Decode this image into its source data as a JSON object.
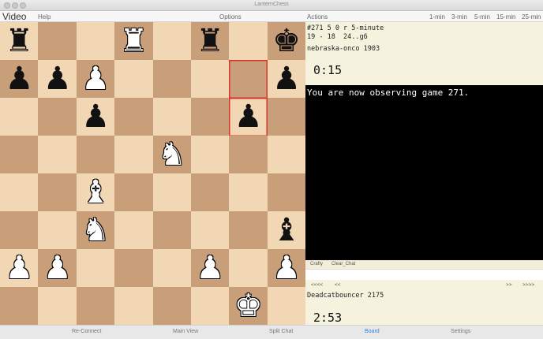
{
  "window": {
    "title": "LanternChess"
  },
  "menubar": {
    "video": "Video",
    "help": "Help",
    "options": "Options",
    "actions": "Actions",
    "time_buttons": [
      "1-min",
      "3-min",
      "5-min",
      "15-min",
      "25-min"
    ]
  },
  "board": {
    "squares": [
      [
        "bR",
        "",
        "",
        "wR",
        "",
        "bR",
        "",
        "bK"
      ],
      [
        "bP",
        "bP",
        "wP",
        "",
        "",
        "",
        "",
        "bP"
      ],
      [
        "",
        "",
        "bP",
        "",
        "",
        "",
        "bP",
        ""
      ],
      [
        "",
        "",
        "",
        "",
        "wN",
        "",
        "",
        ""
      ],
      [
        "",
        "",
        "wB",
        "",
        "",
        "",
        "",
        ""
      ],
      [
        "",
        "",
        "wN",
        "",
        "",
        "",
        "",
        "bB"
      ],
      [
        "wP",
        "wP",
        "",
        "",
        "",
        "wP",
        "",
        "wP"
      ],
      [
        "",
        "",
        "",
        "",
        "",
        "",
        "wK",
        ""
      ]
    ],
    "highlight": [
      [
        1,
        6
      ],
      [
        2,
        6
      ]
    ]
  },
  "game": {
    "line1": "#271 5 0 r 5-minute",
    "line2": "19 - 18  24..g6",
    "top_player": "nebraska-onco 1903",
    "top_clock": "0:15",
    "bottom_player": "Deadcatbouncer 2175",
    "bottom_clock": "2:53"
  },
  "console": {
    "text": "You are now observing game 271."
  },
  "chat": {
    "tab1": "Crafty",
    "tab2": "Clear_Chat",
    "input_value": ""
  },
  "nav": {
    "first": "<<<<",
    "back": "<<",
    "forward": ">>",
    "last": ">>>>"
  },
  "bottom_tabs": [
    "Re-Connect",
    "Main View",
    "Split Chat",
    "Board",
    "Settings"
  ],
  "active_bottom_tab": "Board",
  "colors": {
    "light_square": "#f1d7b4",
    "dark_square": "#c99f7a",
    "highlight": "#d9322a",
    "panel": "#f5f2dd",
    "active_tab": "#2f7fe0"
  }
}
